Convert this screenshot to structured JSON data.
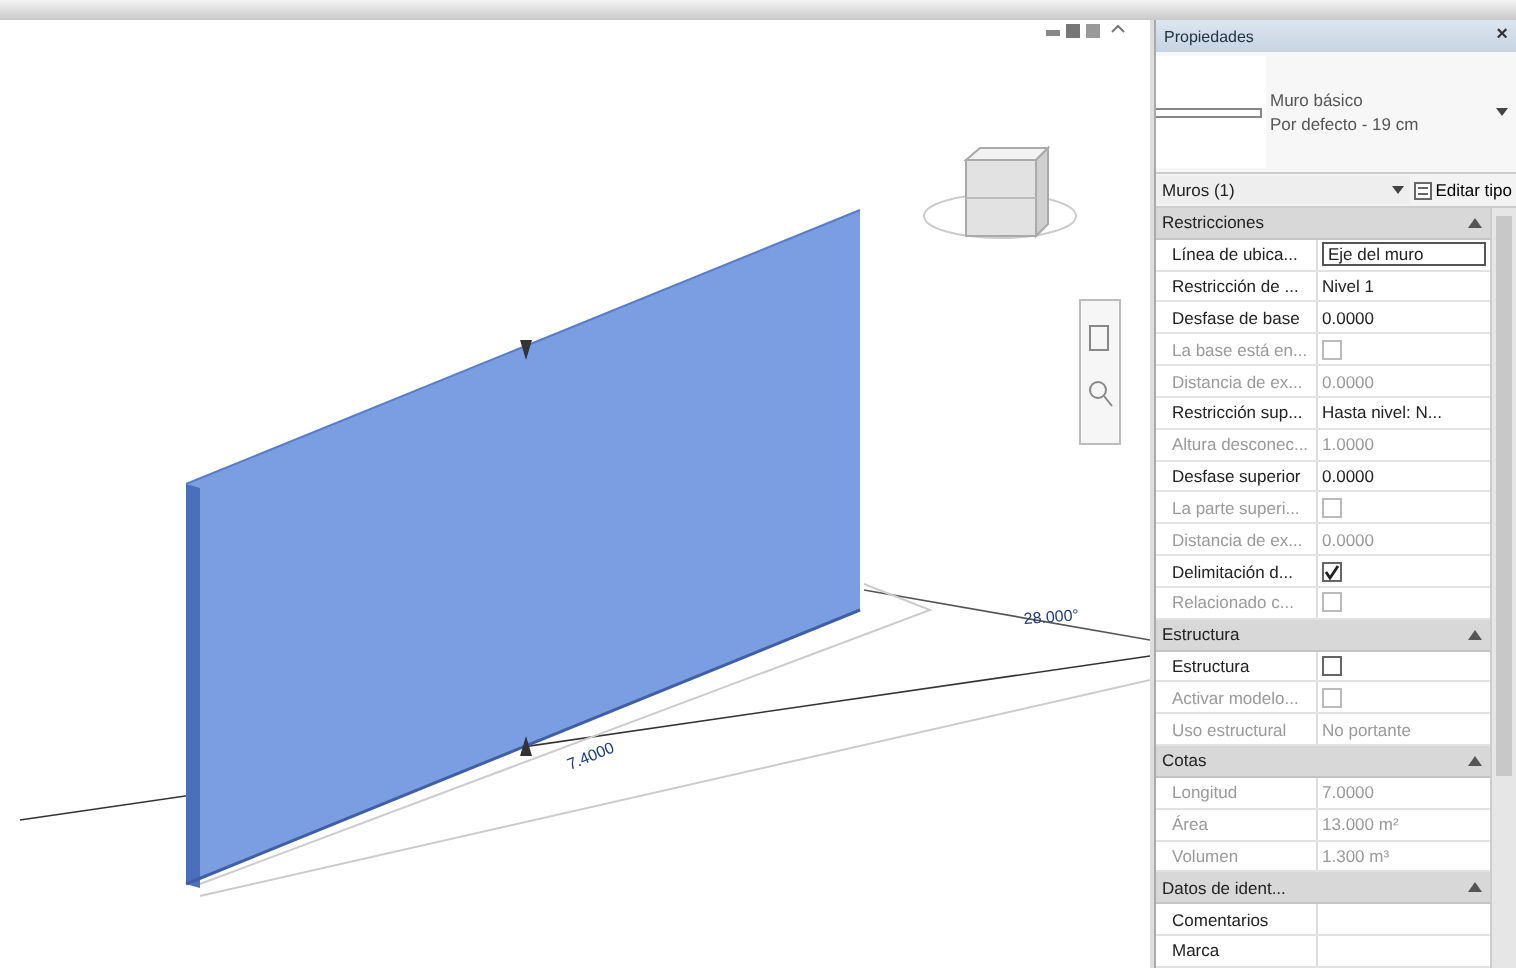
{
  "viewport": {
    "dimension_labels": [
      {
        "text": "7.4000",
        "kind": "length"
      },
      {
        "text": "28.000°",
        "kind": "angle"
      }
    ]
  },
  "properties": {
    "title": "Propiedades",
    "close": "×",
    "type_family": "Muro básico",
    "type_name": "Por defecto - 19 cm",
    "selector": "Muros (1)",
    "edit_type": "Editar tipo",
    "groups": [
      {
        "title": "Restricciones",
        "expanded": true,
        "rows": [
          {
            "label": "Línea de ubica...",
            "kind": "field",
            "value": "Eje del muro",
            "disabled": false
          },
          {
            "label": "Restricción de ...",
            "kind": "text",
            "value": "Nivel 1",
            "disabled": false
          },
          {
            "label": "Desfase de base",
            "kind": "text",
            "value": "0.0000",
            "disabled": false
          },
          {
            "label": "La base está en...",
            "kind": "check",
            "checked": false,
            "disabled": true
          },
          {
            "label": "Distancia de ex...",
            "kind": "text",
            "value": "0.0000",
            "disabled": true
          },
          {
            "label": "Restricción sup...",
            "kind": "text",
            "value": "Hasta nivel: N...",
            "disabled": false
          },
          {
            "label": "Altura desconec...",
            "kind": "text",
            "value": "1.0000",
            "disabled": true
          },
          {
            "label": "Desfase superior",
            "kind": "text",
            "value": "0.0000",
            "disabled": false
          },
          {
            "label": "La parte superi...",
            "kind": "check",
            "checked": false,
            "disabled": true
          },
          {
            "label": "Distancia de ex...",
            "kind": "text",
            "value": "0.0000",
            "disabled": true
          },
          {
            "label": "Delimitación d...",
            "kind": "check",
            "checked": true,
            "disabled": false
          },
          {
            "label": "Relacionado c...",
            "kind": "check",
            "checked": false,
            "disabled": true
          }
        ]
      },
      {
        "title": "Estructura",
        "expanded": true,
        "rows": [
          {
            "label": "Estructura",
            "kind": "check",
            "checked": false,
            "disabled": false
          },
          {
            "label": "Activar modelo...",
            "kind": "check",
            "checked": false,
            "disabled": true
          },
          {
            "label": "Uso estructural",
            "kind": "text",
            "value": "No portante",
            "disabled": true
          }
        ]
      },
      {
        "title": "Cotas",
        "expanded": true,
        "rows": [
          {
            "label": "Longitud",
            "kind": "text",
            "value": "7.0000",
            "disabled": true
          },
          {
            "label": "Área",
            "kind": "text",
            "value": "13.000 m²",
            "disabled": true
          },
          {
            "label": "Volumen",
            "kind": "text",
            "value": "1.300 m³",
            "disabled": true
          }
        ]
      },
      {
        "title": "Datos de ident...",
        "expanded": true,
        "rows": [
          {
            "label": "Comentarios",
            "kind": "text",
            "value": "",
            "disabled": false
          },
          {
            "label": "Marca",
            "kind": "text",
            "value": "",
            "disabled": false
          }
        ]
      }
    ]
  }
}
